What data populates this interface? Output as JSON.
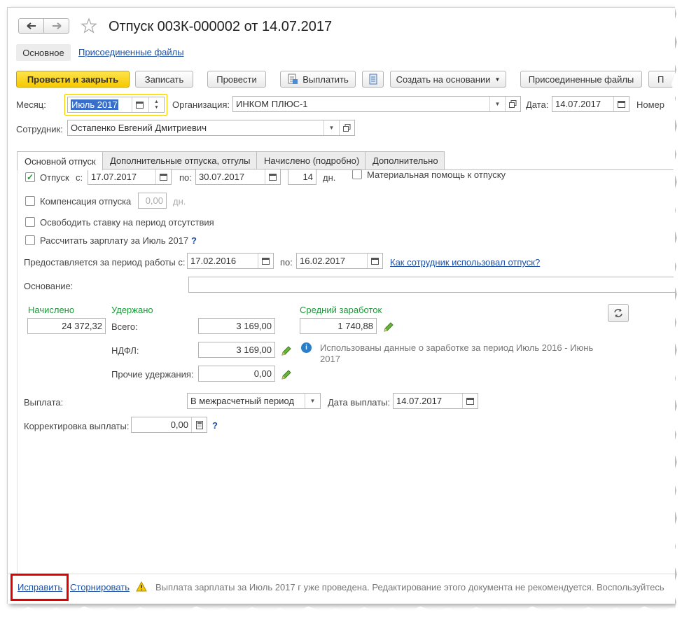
{
  "header": {
    "title": "Отпуск 003К-000002 от 14.07.2017",
    "nav_main": "Основное",
    "nav_files": "Присоединенные файлы"
  },
  "toolbar": {
    "post_close": "Провести и закрыть",
    "save": "Записать",
    "post": "Провести",
    "pay": "Выплатить",
    "create_based": "Создать на основании",
    "attached_files": "Присоединенные файлы",
    "cut_button": "П"
  },
  "row1": {
    "month_label": "Месяц:",
    "month_value": "Июль 2017",
    "org_label": "Организация:",
    "org_value": "ИНКОМ ПЛЮС-1",
    "date_label": "Дата:",
    "date_value": "14.07.2017",
    "number_label": "Номер"
  },
  "employee": {
    "label": "Сотрудник:",
    "value": "Остапенко Евгений Дмитриевич"
  },
  "tabs": [
    "Основной отпуск",
    "Дополнительные отпуска, отгулы",
    "Начислено (подробно)",
    "Дополнительно"
  ],
  "vacation": {
    "label": "Отпуск",
    "from_label": "с:",
    "from": "17.07.2017",
    "to_label": "по:",
    "to": "30.07.2017",
    "days": "14",
    "days_unit": "дн.",
    "material_help": "Материальная помощь к отпуску"
  },
  "compensation": {
    "label": "Компенсация отпуска",
    "value": "0,00",
    "unit": "дн."
  },
  "release_rate": "Освободить ставку на период отсутствия",
  "calc_salary": "Рассчитать зарплату за Июль 2017",
  "help_mark": "?",
  "work_period": {
    "label": "Предоставляется за период работы с:",
    "from": "17.02.2016",
    "to_label": "по:",
    "to": "16.02.2017",
    "link": "Как сотрудник использовал отпуск?"
  },
  "basis": {
    "label": "Основание:",
    "value": ""
  },
  "accrued": {
    "label": "Начислено",
    "value": "24 372,32"
  },
  "withheld": {
    "label": "Удержано",
    "total_label": "Всего:",
    "total": "3 169,00",
    "ndfl_label": "НДФЛ:",
    "ndfl": "3 169,00",
    "other_label": "Прочие удержания:",
    "other": "0,00"
  },
  "average": {
    "label": "Средний заработок",
    "value": "1 740,88",
    "info_line1": "Использованы данные о заработке за период Июль 2016 - Июнь",
    "info_line2": "2017"
  },
  "payout": {
    "label": "Выплата:",
    "value": "В межрасчетный период",
    "date_label": "Дата выплаты:",
    "date": "14.07.2017"
  },
  "correction": {
    "label": "Корректировка выплаты:",
    "value": "0,00"
  },
  "footer": {
    "fix": "Исправить",
    "reverse": "Сторнировать",
    "warning": "Выплата зарплаты за Июль 2017 г уже проведена. Редактирование этого документа не рекомендуется. Воспользуйтесь"
  },
  "colors": {
    "accent_yellow": "#f5c800",
    "highlight_red": "#e00000",
    "green": "#1e9a3c",
    "link": "#1d4fa4"
  }
}
